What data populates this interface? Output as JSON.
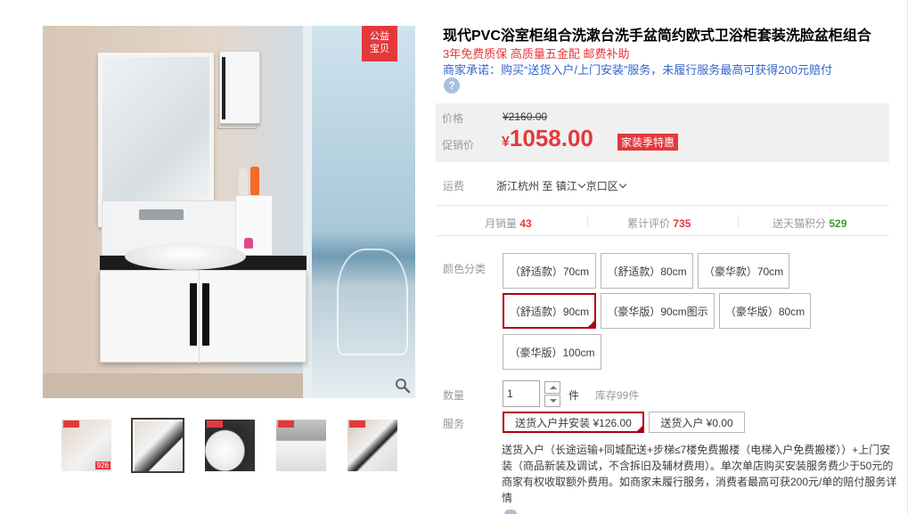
{
  "gallery": {
    "badge_line1": "公益",
    "badge_line2": "宝贝",
    "thumbnails": [
      {
        "price": "926",
        "has_tag": true
      },
      {
        "price": "",
        "has_tag": false
      },
      {
        "price": "",
        "has_tag": true
      },
      {
        "price": "",
        "has_tag": true
      },
      {
        "price": "",
        "has_tag": true
      }
    ],
    "selected_thumb": 1
  },
  "product": {
    "title": "现代PVC浴室柜组合洗漱台洗手盆简约欧式卫浴柜套装洗脸盆柜组合",
    "subtitle": "3年免费质保 高质量五金配 邮费补助",
    "promise": "商家承诺：购买“送货入户/上门安装”服务，未履行服务最高可获得200元赔付",
    "help_icon": "?"
  },
  "price": {
    "orig_label": "价格",
    "orig_value": "¥2160.00",
    "promo_label": "促销价",
    "currency": "¥",
    "promo_value": "1058.00",
    "promo_tag": "家装季特惠"
  },
  "shipping": {
    "label": "运费",
    "from": "浙江杭州",
    "to_word": "至",
    "city": "镇江",
    "district": "京口区"
  },
  "stats": {
    "monthly_label": "月销量",
    "monthly_value": "43",
    "reviews_label": "累计评价",
    "reviews_value": "735",
    "points_label": "送天猫积分",
    "points_value": "529"
  },
  "color": {
    "label": "颜色分类",
    "options": [
      "（舒适款）70cm",
      "（舒适款）80cm",
      "（豪华款）70cm",
      "（舒适款）90cm",
      "（豪华版）90cm图示",
      "（豪华版）80cm",
      "（豪华版）100cm"
    ],
    "selected_index": 3
  },
  "quantity": {
    "label": "数量",
    "value": "1",
    "unit": "件",
    "stock": "库存99件"
  },
  "service": {
    "label": "服务",
    "options": [
      "送货入户并安装 ¥126.00",
      "送货入户 ¥0.00"
    ],
    "selected_index": 0,
    "description": "送货入户（长途运输+同城配送+步梯≤7楼免费搬楼（电梯入户免费搬楼））+上门安装（商品新装及调试，不含拆旧及辅材费用）。单次单店购买安装服务费少于50元的商家有权收取额外费用。如商家未履行服务，消费者最高可获200元/单的赔付服务详情"
  },
  "colors": {
    "accent_red": "#e4393c",
    "selected_border": "#b0000f",
    "link_blue": "#3366cc",
    "points_green": "#3c9d2c"
  }
}
